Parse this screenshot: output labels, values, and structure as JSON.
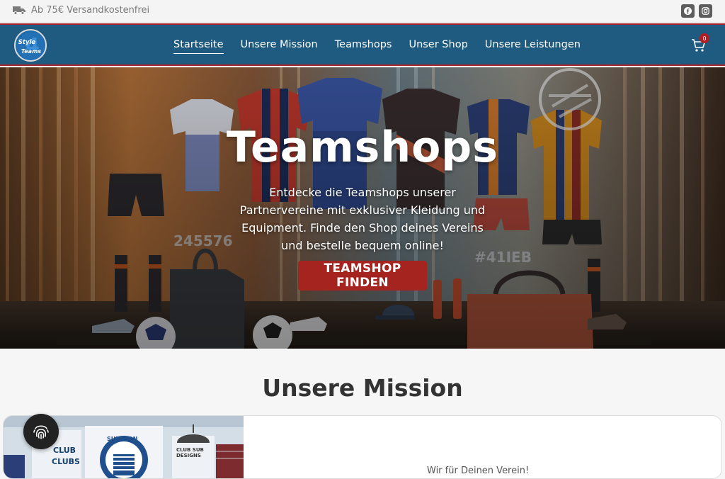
{
  "topbar": {
    "shipping_text": "Ab 75€ Versandkostenfrei",
    "truck_icon": "truck-icon",
    "socials": [
      "facebook-icon",
      "instagram-icon"
    ]
  },
  "nav": {
    "items": [
      {
        "label": "Startseite",
        "active": true
      },
      {
        "label": "Unsere Mission",
        "active": false
      },
      {
        "label": "Teamshops",
        "active": false
      },
      {
        "label": "Unser Shop",
        "active": false
      },
      {
        "label": "Unsere Leistungen",
        "active": false
      }
    ],
    "cart_count": "0",
    "logo_icon": "style4teams-logo"
  },
  "hero": {
    "title": "Teamshops",
    "text": "Entdecke die Teamshops unserer Partnervereine mit exklusiver Kleidung und Equipment. Finde den Shop deines Vereins und bestelle bequem online!",
    "cta_label": "TEAMSHOP FINDEN"
  },
  "mission": {
    "title": "Unsere Mission",
    "teaser": "Wir für Deinen Verein!",
    "image_label_left": "CLUB",
    "image_label_left2": "CLUBS",
    "image_label_mid": "SUPISION",
    "image_label_right": "CLUB SUB DESIGNS"
  },
  "colors": {
    "nav_bg": "#1f5a80",
    "accent": "#a8262b",
    "cta": "#a5241f"
  }
}
